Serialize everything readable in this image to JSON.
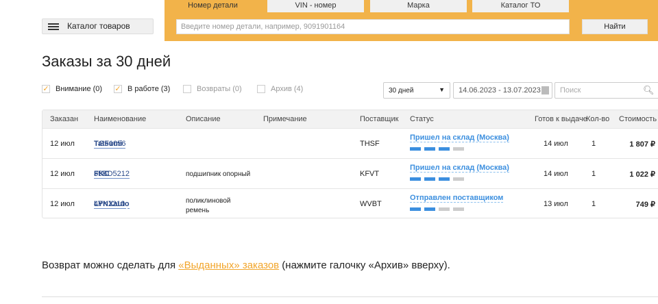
{
  "header": {
    "catalog_button": "Каталог товаров",
    "tabs": [
      "Номер детали",
      "VIN - номер",
      "Марка",
      "Каталог ТО"
    ],
    "search_placeholder": "Введите номер детали, например, 9091901164",
    "find_button": "Найти"
  },
  "page_title": "Заказы за 30 дней",
  "filters": [
    {
      "label": "Внимание (0)",
      "checked": true
    },
    {
      "label": "В работе (3)",
      "checked": true
    },
    {
      "label": "Возвраты (0)",
      "checked": false
    },
    {
      "label": "Архив (4)",
      "checked": false
    }
  ],
  "period": {
    "selected": "30 дней",
    "range": "14.06.2023 - 13.07.2023",
    "search_placeholder": "Поиск"
  },
  "table": {
    "columns": [
      "Заказан",
      "Наименование",
      "Описание",
      "Примечание",
      "Поставщик",
      "Статус",
      "Готов к выдаче",
      "Кол-во",
      "Стоимость"
    ],
    "rows": [
      {
        "date": "12 июл",
        "brand": "Tatsumi",
        "article": "TGF1056",
        "desc1": "",
        "desc2": "",
        "note": "",
        "supplier": "THSF",
        "status": "Пришел на склад (Москва)",
        "progress": 3,
        "ready": "14 июл",
        "qty": "1",
        "price": "1 807 ₽"
      },
      {
        "date": "12 июл",
        "brand": "FKC",
        "article": "35BD5212",
        "desc1": "подшипник опорный",
        "desc2": "",
        "note": "",
        "supplier": "KFVT",
        "status": "Пришел на склад (Москва)",
        "progress": 3,
        "ready": "14 июл",
        "qty": "1",
        "price": "1 022 ₽"
      },
      {
        "date": "12 июл",
        "brand": "LYNXauto",
        "article": "4PK1210",
        "desc1": "поликлиновой",
        "desc2": "ремень",
        "note": "",
        "supplier": "WVBT",
        "status": "Отправлен поставщиком",
        "progress": 2,
        "ready": "13 июл",
        "qty": "1",
        "price": "749 ₽"
      }
    ]
  },
  "footer": {
    "pre": "Возврат можно сделать для ",
    "link": "«Выданных» заказов",
    "post": " (нажмите галочку «Архив» вверху)."
  },
  "colors": {
    "accent": "#f2b34a",
    "link": "#3c8fdf"
  }
}
